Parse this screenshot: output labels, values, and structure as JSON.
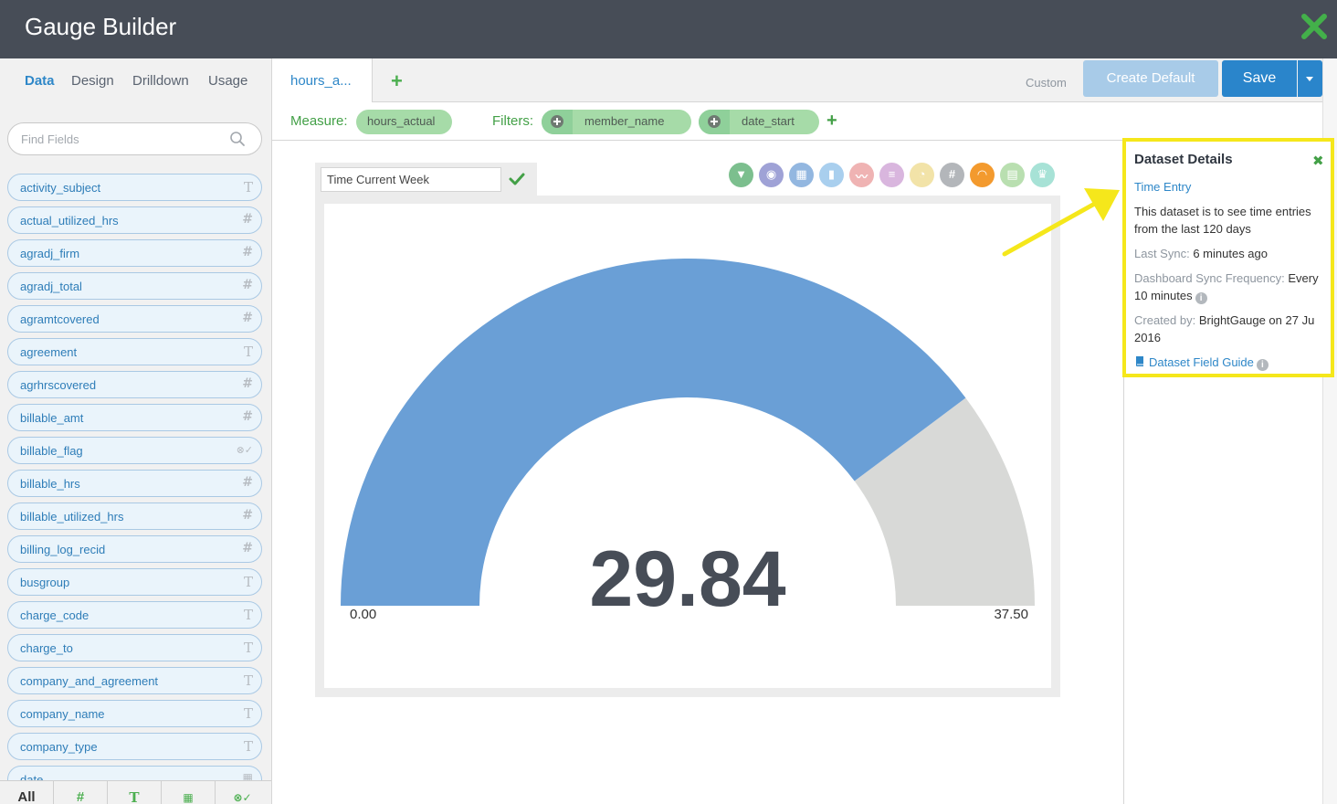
{
  "window": {
    "title": "Gauge Builder"
  },
  "left_tabs": [
    "Data",
    "Design",
    "Drilldown",
    "Usage"
  ],
  "search": {
    "placeholder": "Find Fields"
  },
  "fields": [
    {
      "name": "activity_subject",
      "type": "T"
    },
    {
      "name": "actual_utilized_hrs",
      "type": "#"
    },
    {
      "name": "agradj_firm",
      "type": "#"
    },
    {
      "name": "agradj_total",
      "type": "#"
    },
    {
      "name": "agramtcovered",
      "type": "#"
    },
    {
      "name": "agreement",
      "type": "T"
    },
    {
      "name": "agrhrscovered",
      "type": "#"
    },
    {
      "name": "billable_amt",
      "type": "#"
    },
    {
      "name": "billable_flag",
      "type": "⊗✓"
    },
    {
      "name": "billable_hrs",
      "type": "#"
    },
    {
      "name": "billable_utilized_hrs",
      "type": "#"
    },
    {
      "name": "billing_log_recid",
      "type": "#"
    },
    {
      "name": "busgroup",
      "type": "T"
    },
    {
      "name": "charge_code",
      "type": "T"
    },
    {
      "name": "charge_to",
      "type": "T"
    },
    {
      "name": "company_and_agreement",
      "type": "T"
    },
    {
      "name": "company_name",
      "type": "T"
    },
    {
      "name": "company_type",
      "type": "T"
    },
    {
      "name": "date",
      "type": "▦"
    }
  ],
  "type_filters": [
    "All",
    "#",
    "T",
    "▦",
    "⊗✓"
  ],
  "main_tab": {
    "label": "hours_a..."
  },
  "toolbar": {
    "custom": "Custom",
    "create_default": "Create Default",
    "save": "Save"
  },
  "query": {
    "measure_label": "Measure:",
    "measure": "hours_actual",
    "filters_label": "Filters:",
    "filters": [
      "member_name",
      "date_start"
    ]
  },
  "gauge": {
    "title_value": "Time Current Week",
    "value": 29.84,
    "value_text": "29.84",
    "min": 0,
    "max": 37.5,
    "min_label": "0.00",
    "max_label": "37.50",
    "fill_color": "#6a9fd6",
    "rest_color": "#d8d9d7",
    "value_color": "#474d57"
  },
  "chart_types": [
    {
      "icon": "funnel-icon",
      "color": "#7cbf8e",
      "glyph": "▼"
    },
    {
      "icon": "camera-icon",
      "color": "#9fa2d6",
      "glyph": "◉"
    },
    {
      "icon": "table-icon",
      "color": "#93b7e0",
      "glyph": "▦"
    },
    {
      "icon": "bar-chart-icon",
      "color": "#a9cfee",
      "glyph": "▮"
    },
    {
      "icon": "sparkline-icon",
      "color": "#efb3b3",
      "glyph": "〰"
    },
    {
      "icon": "horizontal-bar-icon",
      "color": "#d9b6de",
      "glyph": "≡"
    },
    {
      "icon": "pie-icon",
      "color": "#f2e3a8",
      "glyph": "◔"
    },
    {
      "icon": "number-icon",
      "color": "#b3b6ba",
      "glyph": "#"
    },
    {
      "icon": "gauge-icon",
      "color": "#f39a2e",
      "glyph": "◠"
    },
    {
      "icon": "list-icon",
      "color": "#b9dfb0",
      "glyph": "▤"
    },
    {
      "icon": "trophy-icon",
      "color": "#a7e2d6",
      "glyph": "♛"
    }
  ],
  "dataset": {
    "title": "Dataset Details",
    "name": "Time Entry",
    "desc_line1": "This dataset is to see time entries",
    "desc_line2": "from the last 120 days",
    "last_sync_label": "Last Sync:",
    "last_sync_value": "6 minutes ago",
    "sync_freq_label": "Dashboard Sync Frequency:",
    "sync_freq_value": "Every",
    "sync_freq_line2": "10 minutes",
    "created_label": "Created by:",
    "created_value": "BrightGauge on 27 Ju",
    "created_line2": "2016",
    "guide": "Dataset Field Guide"
  },
  "colors": {
    "accent": "#2a85cb",
    "green": "#43a047",
    "highlight": "#f5e71b",
    "titlebar": "#474d57"
  }
}
